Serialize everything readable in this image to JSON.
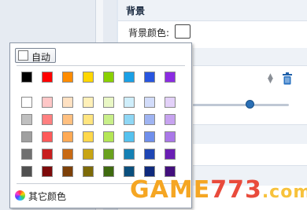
{
  "background_panel": {
    "section_title": "背景",
    "bg_color_label": "背景颜色:",
    "bg_color_value": "#ffffff"
  },
  "color_picker": {
    "auto_label": "自动",
    "auto_color": "#ffffff",
    "more_colors_label": "其它颜色",
    "standard_colors": [
      "#000000",
      "#ff0000",
      "#ff8c00",
      "#ffd700",
      "#8ad000",
      "#1aa0e6",
      "#2855e0",
      "#8b2be2"
    ],
    "shade_rows": [
      [
        "#ffffff",
        "#ffc7c7",
        "#ffe1c2",
        "#fff0b8",
        "#e9f7c5",
        "#cfeefb",
        "#d2dcfa",
        "#e3d1f9"
      ],
      [
        "#c0c0c0",
        "#ff8080",
        "#ffc080",
        "#ffe580",
        "#c9ef8a",
        "#8fd7f5",
        "#9fb4f2",
        "#c7a3f0"
      ],
      [
        "#a0a0a0",
        "#ff5a5a",
        "#ffaa55",
        "#ffd84a",
        "#b4e655",
        "#55c2ef",
        "#6f8fec",
        "#aa78e8"
      ],
      [
        "#707070",
        "#c81e1e",
        "#c86a14",
        "#c8a514",
        "#6aa21e",
        "#1480b4",
        "#1e46b4",
        "#6a1eb4"
      ],
      [
        "#505050",
        "#7d0a0a",
        "#7d4008",
        "#7d6a08",
        "#3f6a0f",
        "#0a4f7d",
        "#0f2a7d",
        "#420f7d"
      ]
    ]
  },
  "watermark": {
    "brand": "GAME773",
    "suffix": ".com"
  }
}
